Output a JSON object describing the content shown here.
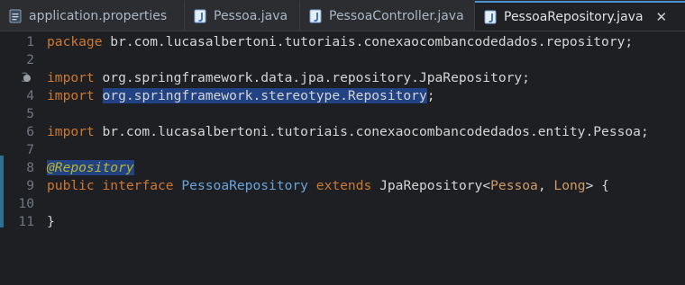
{
  "tabs": [
    {
      "label": "application.properties",
      "icon": "properties-file-icon",
      "active": false
    },
    {
      "label": "Pessoa.java",
      "icon": "java-file-icon",
      "active": false
    },
    {
      "label": "PessoaController.java",
      "icon": "java-file-icon",
      "active": false
    },
    {
      "label": "PessoaRepository.java",
      "icon": "java-file-icon",
      "active": true,
      "close": "✕"
    }
  ],
  "editor": {
    "line_numbers": [
      "1",
      "2",
      "3",
      "4",
      "5",
      "6",
      "7",
      "8",
      "9",
      "10",
      "11"
    ],
    "lines": {
      "l1": {
        "kw": "package",
        "rest": " br.com.lucasalbertoni.tutoriais.conexaocombancodedados.repository;"
      },
      "l3": {
        "kw": "import",
        "rest": " org.springframework.data.jpa.repository.JpaRepository;"
      },
      "l4": {
        "kw": "import",
        "sel": "org.springframework.stereotype.Repository",
        "end": ";"
      },
      "l6": {
        "kw": "import",
        "rest": " br.com.lucasalbertoni.tutoriais.conexaocombancodedados.entity.Pessoa;"
      },
      "l8": {
        "ann": "@Repository"
      },
      "l9": {
        "kw1": "public",
        "kw2": "interface",
        "name": "PessoaRepository",
        "kw3": "extends",
        "super": "JpaRepository",
        "lt": "<",
        "t1": "Pessoa",
        "comma": ", ",
        "t2": "Long",
        "gt": "> {"
      },
      "l11": {
        "brace": "}"
      }
    }
  },
  "colors": {
    "background": "#1e1f22",
    "keyword": "#cc7832",
    "selection": "#214283",
    "annotation": "#bbb529",
    "type": "#67a5dc",
    "generic": "#d19a66",
    "active_tab_accent": "#4a8fcf"
  }
}
